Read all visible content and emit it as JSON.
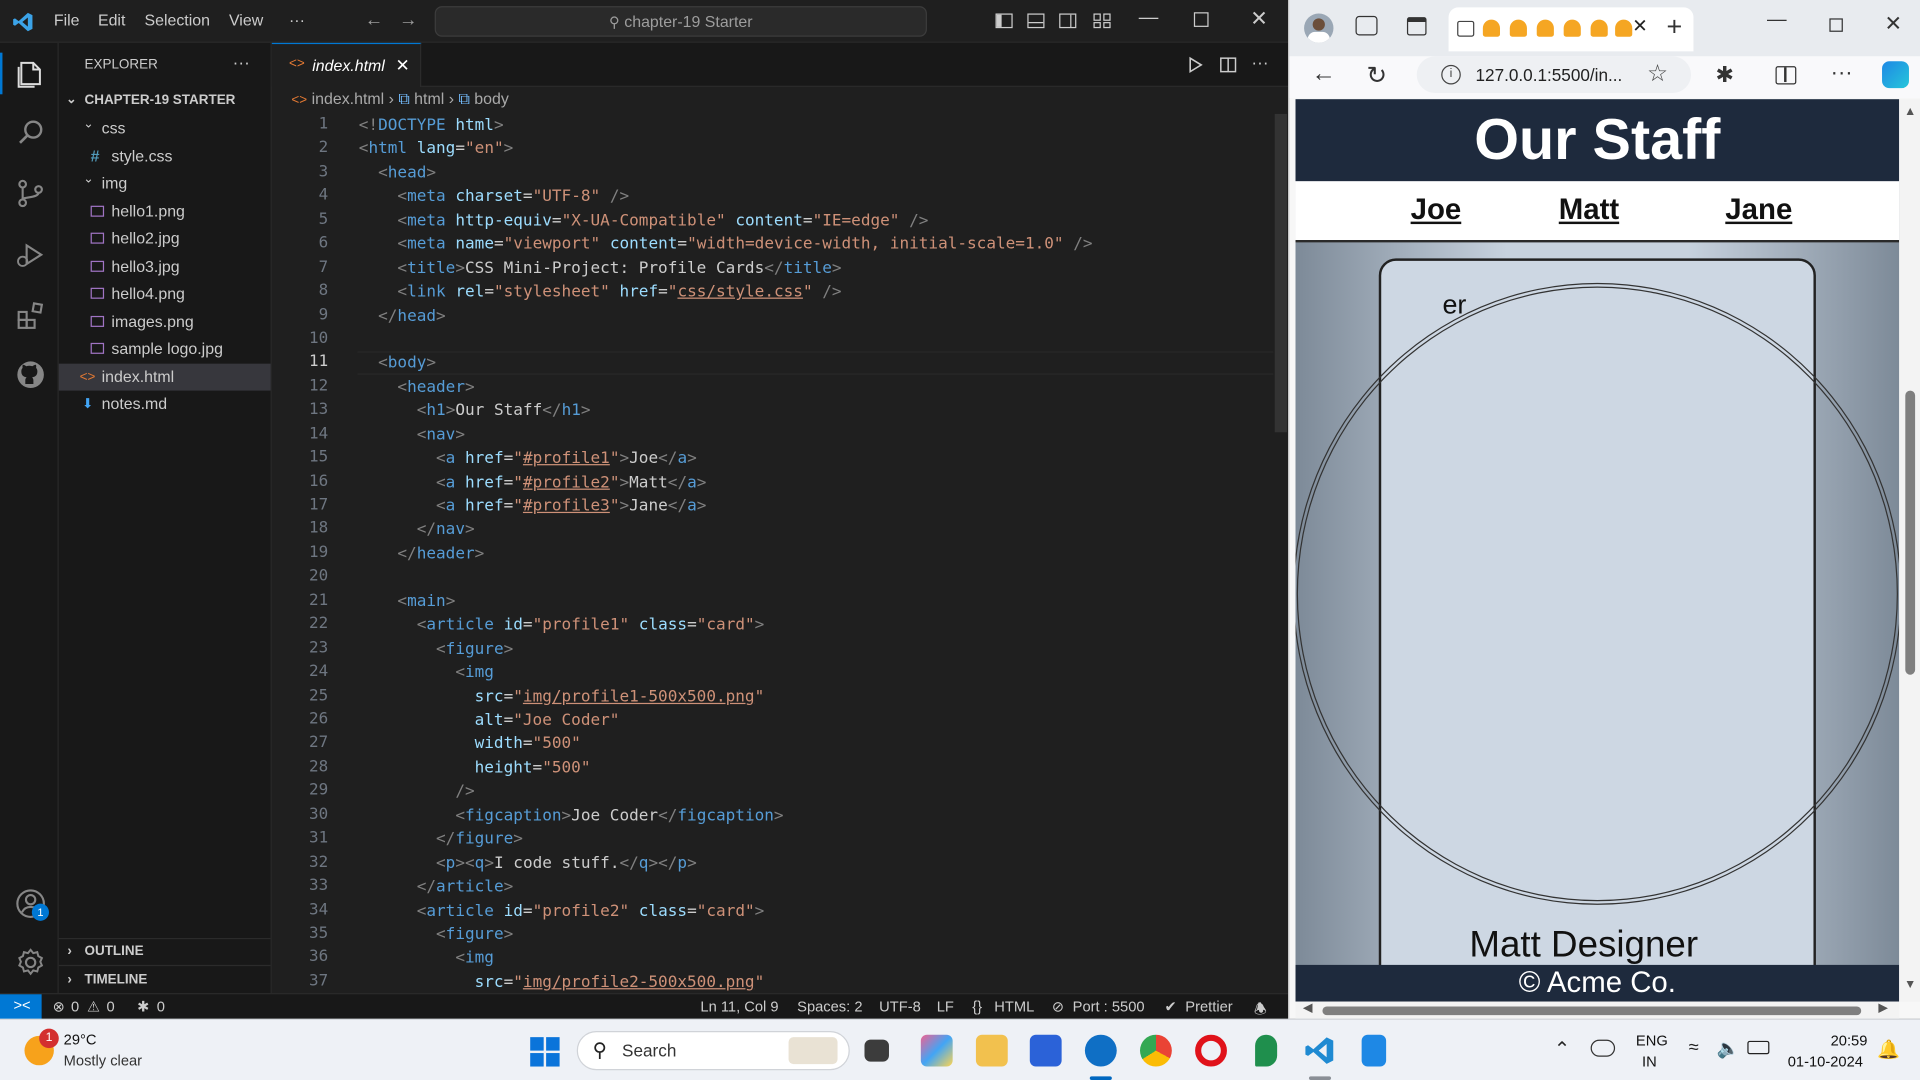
{
  "vscode": {
    "menu": [
      "File",
      "Edit",
      "Selection",
      "View",
      "···"
    ],
    "command_center": "chapter-19 Starter",
    "explorer": {
      "title": "EXPLORER",
      "more": "···",
      "root": "CHAPTER-19 STARTER",
      "items": [
        {
          "label": "css",
          "kind": "folder"
        },
        {
          "label": "style.css",
          "kind": "css"
        },
        {
          "label": "img",
          "kind": "folder"
        },
        {
          "label": "hello1.png",
          "kind": "image"
        },
        {
          "label": "hello2.jpg",
          "kind": "image"
        },
        {
          "label": "hello3.jpg",
          "kind": "image"
        },
        {
          "label": "hello4.png",
          "kind": "image"
        },
        {
          "label": "images.png",
          "kind": "image"
        },
        {
          "label": "sample logo.jpg",
          "kind": "image"
        },
        {
          "label": "index.html",
          "kind": "html"
        },
        {
          "label": "notes.md",
          "kind": "markdown"
        }
      ],
      "outline": "OUTLINE",
      "timeline": "TIMELINE"
    },
    "tab": {
      "label": "index.html",
      "close": "✕"
    },
    "breadcrumb": [
      "index.html",
      "html",
      "body"
    ],
    "current_line": 11,
    "line_numbers": [
      "1",
      "2",
      "3",
      "4",
      "5",
      "6",
      "7",
      "8",
      "9",
      "10",
      "11",
      "12",
      "13",
      "14",
      "15",
      "16",
      "17",
      "18",
      "19",
      "20",
      "21",
      "22",
      "23",
      "24",
      "25",
      "26",
      "27",
      "28",
      "29",
      "30",
      "31",
      "32",
      "33",
      "34",
      "35",
      "36",
      "37"
    ],
    "code": [
      [
        [
          "g",
          "<!"
        ],
        [
          "t",
          "DOCTYPE"
        ],
        [
          "p",
          " "
        ],
        [
          "a",
          "html"
        ],
        [
          "g",
          ">"
        ]
      ],
      [
        [
          "g",
          "<"
        ],
        [
          "t",
          "html"
        ],
        [
          "p",
          " "
        ],
        [
          "a",
          "lang"
        ],
        [
          "p",
          "="
        ],
        [
          "s",
          "\"en\""
        ],
        [
          "g",
          ">"
        ]
      ],
      [
        [
          "p",
          "  "
        ],
        [
          "g",
          "<"
        ],
        [
          "t",
          "head"
        ],
        [
          "g",
          ">"
        ]
      ],
      [
        [
          "p",
          "    "
        ],
        [
          "g",
          "<"
        ],
        [
          "t",
          "meta"
        ],
        [
          "p",
          " "
        ],
        [
          "a",
          "charset"
        ],
        [
          "p",
          "="
        ],
        [
          "s",
          "\"UTF-8\""
        ],
        [
          "p",
          " "
        ],
        [
          "g",
          "/>"
        ]
      ],
      [
        [
          "p",
          "    "
        ],
        [
          "g",
          "<"
        ],
        [
          "t",
          "meta"
        ],
        [
          "p",
          " "
        ],
        [
          "a",
          "http-equiv"
        ],
        [
          "p",
          "="
        ],
        [
          "s",
          "\"X-UA-Compatible\""
        ],
        [
          "p",
          " "
        ],
        [
          "a",
          "content"
        ],
        [
          "p",
          "="
        ],
        [
          "s",
          "\"IE=edge\""
        ],
        [
          "p",
          " "
        ],
        [
          "g",
          "/>"
        ]
      ],
      [
        [
          "p",
          "    "
        ],
        [
          "g",
          "<"
        ],
        [
          "t",
          "meta"
        ],
        [
          "p",
          " "
        ],
        [
          "a",
          "name"
        ],
        [
          "p",
          "="
        ],
        [
          "s",
          "\"viewport\""
        ],
        [
          "p",
          " "
        ],
        [
          "a",
          "content"
        ],
        [
          "p",
          "="
        ],
        [
          "s",
          "\"width=device-width, initial-scale=1.0\""
        ],
        [
          "p",
          " "
        ],
        [
          "g",
          "/>"
        ]
      ],
      [
        [
          "p",
          "    "
        ],
        [
          "g",
          "<"
        ],
        [
          "t",
          "title"
        ],
        [
          "g",
          ">"
        ],
        [
          "p",
          "CSS Mini-Project: Profile Cards"
        ],
        [
          "g",
          "</"
        ],
        [
          "t",
          "title"
        ],
        [
          "g",
          ">"
        ]
      ],
      [
        [
          "p",
          "    "
        ],
        [
          "g",
          "<"
        ],
        [
          "t",
          "link"
        ],
        [
          "p",
          " "
        ],
        [
          "a",
          "rel"
        ],
        [
          "p",
          "="
        ],
        [
          "s",
          "\"stylesheet\""
        ],
        [
          "p",
          " "
        ],
        [
          "a",
          "href"
        ],
        [
          "p",
          "="
        ],
        [
          "s",
          "\""
        ],
        [
          "su",
          "css/style.css"
        ],
        [
          "s",
          "\""
        ],
        [
          "p",
          " "
        ],
        [
          "g",
          "/>"
        ]
      ],
      [
        [
          "p",
          "  "
        ],
        [
          "g",
          "</"
        ],
        [
          "t",
          "head"
        ],
        [
          "g",
          ">"
        ]
      ],
      [
        [
          "p",
          ""
        ]
      ],
      [
        [
          "p",
          "  "
        ],
        [
          "g",
          "<"
        ],
        [
          "t",
          "body"
        ],
        [
          "g",
          ">"
        ]
      ],
      [
        [
          "p",
          "    "
        ],
        [
          "g",
          "<"
        ],
        [
          "t",
          "header"
        ],
        [
          "g",
          ">"
        ]
      ],
      [
        [
          "p",
          "      "
        ],
        [
          "g",
          "<"
        ],
        [
          "t",
          "h1"
        ],
        [
          "g",
          ">"
        ],
        [
          "p",
          "Our Staff"
        ],
        [
          "g",
          "</"
        ],
        [
          "t",
          "h1"
        ],
        [
          "g",
          ">"
        ]
      ],
      [
        [
          "p",
          "      "
        ],
        [
          "g",
          "<"
        ],
        [
          "t",
          "nav"
        ],
        [
          "g",
          ">"
        ]
      ],
      [
        [
          "p",
          "        "
        ],
        [
          "g",
          "<"
        ],
        [
          "t",
          "a"
        ],
        [
          "p",
          " "
        ],
        [
          "a",
          "href"
        ],
        [
          "p",
          "="
        ],
        [
          "s",
          "\""
        ],
        [
          "su",
          "#profile1"
        ],
        [
          "s",
          "\""
        ],
        [
          "g",
          ">"
        ],
        [
          "p",
          "Joe"
        ],
        [
          "g",
          "</"
        ],
        [
          "t",
          "a"
        ],
        [
          "g",
          ">"
        ]
      ],
      [
        [
          "p",
          "        "
        ],
        [
          "g",
          "<"
        ],
        [
          "t",
          "a"
        ],
        [
          "p",
          " "
        ],
        [
          "a",
          "href"
        ],
        [
          "p",
          "="
        ],
        [
          "s",
          "\""
        ],
        [
          "su",
          "#profile2"
        ],
        [
          "s",
          "\""
        ],
        [
          "g",
          ">"
        ],
        [
          "p",
          "Matt"
        ],
        [
          "g",
          "</"
        ],
        [
          "t",
          "a"
        ],
        [
          "g",
          ">"
        ]
      ],
      [
        [
          "p",
          "        "
        ],
        [
          "g",
          "<"
        ],
        [
          "t",
          "a"
        ],
        [
          "p",
          " "
        ],
        [
          "a",
          "href"
        ],
        [
          "p",
          "="
        ],
        [
          "s",
          "\""
        ],
        [
          "su",
          "#profile3"
        ],
        [
          "s",
          "\""
        ],
        [
          "g",
          ">"
        ],
        [
          "p",
          "Jane"
        ],
        [
          "g",
          "</"
        ],
        [
          "t",
          "a"
        ],
        [
          "g",
          ">"
        ]
      ],
      [
        [
          "p",
          "      "
        ],
        [
          "g",
          "</"
        ],
        [
          "t",
          "nav"
        ],
        [
          "g",
          ">"
        ]
      ],
      [
        [
          "p",
          "    "
        ],
        [
          "g",
          "</"
        ],
        [
          "t",
          "header"
        ],
        [
          "g",
          ">"
        ]
      ],
      [
        [
          "p",
          ""
        ]
      ],
      [
        [
          "p",
          "    "
        ],
        [
          "g",
          "<"
        ],
        [
          "t",
          "main"
        ],
        [
          "g",
          ">"
        ]
      ],
      [
        [
          "p",
          "      "
        ],
        [
          "g",
          "<"
        ],
        [
          "t",
          "article"
        ],
        [
          "p",
          " "
        ],
        [
          "a",
          "id"
        ],
        [
          "p",
          "="
        ],
        [
          "s",
          "\"profile1\""
        ],
        [
          "p",
          " "
        ],
        [
          "a",
          "class"
        ],
        [
          "p",
          "="
        ],
        [
          "s",
          "\"card\""
        ],
        [
          "g",
          ">"
        ]
      ],
      [
        [
          "p",
          "        "
        ],
        [
          "g",
          "<"
        ],
        [
          "t",
          "figure"
        ],
        [
          "g",
          ">"
        ]
      ],
      [
        [
          "p",
          "          "
        ],
        [
          "g",
          "<"
        ],
        [
          "t",
          "img"
        ]
      ],
      [
        [
          "p",
          "            "
        ],
        [
          "a",
          "src"
        ],
        [
          "p",
          "="
        ],
        [
          "s",
          "\""
        ],
        [
          "su",
          "img/profile1-500x500.png"
        ],
        [
          "s",
          "\""
        ]
      ],
      [
        [
          "p",
          "            "
        ],
        [
          "a",
          "alt"
        ],
        [
          "p",
          "="
        ],
        [
          "s",
          "\"Joe Coder\""
        ]
      ],
      [
        [
          "p",
          "            "
        ],
        [
          "a",
          "width"
        ],
        [
          "p",
          "="
        ],
        [
          "s",
          "\"500\""
        ]
      ],
      [
        [
          "p",
          "            "
        ],
        [
          "a",
          "height"
        ],
        [
          "p",
          "="
        ],
        [
          "s",
          "\"500\""
        ]
      ],
      [
        [
          "p",
          "          "
        ],
        [
          "g",
          "/>"
        ]
      ],
      [
        [
          "p",
          "          "
        ],
        [
          "g",
          "<"
        ],
        [
          "t",
          "figcaption"
        ],
        [
          "g",
          ">"
        ],
        [
          "p",
          "Joe Coder"
        ],
        [
          "g",
          "</"
        ],
        [
          "t",
          "figcaption"
        ],
        [
          "g",
          ">"
        ]
      ],
      [
        [
          "p",
          "        "
        ],
        [
          "g",
          "</"
        ],
        [
          "t",
          "figure"
        ],
        [
          "g",
          ">"
        ]
      ],
      [
        [
          "p",
          "        "
        ],
        [
          "g",
          "<"
        ],
        [
          "t",
          "p"
        ],
        [
          "g",
          "><"
        ],
        [
          "t",
          "q"
        ],
        [
          "g",
          ">"
        ],
        [
          "p",
          "I code stuff."
        ],
        [
          "g",
          "</"
        ],
        [
          "t",
          "q"
        ],
        [
          "g",
          "></"
        ],
        [
          "t",
          "p"
        ],
        [
          "g",
          ">"
        ]
      ],
      [
        [
          "p",
          "      "
        ],
        [
          "g",
          "</"
        ],
        [
          "t",
          "article"
        ],
        [
          "g",
          ">"
        ]
      ],
      [
        [
          "p",
          "      "
        ],
        [
          "g",
          "<"
        ],
        [
          "t",
          "article"
        ],
        [
          "p",
          " "
        ],
        [
          "a",
          "id"
        ],
        [
          "p",
          "="
        ],
        [
          "s",
          "\"profile2\""
        ],
        [
          "p",
          " "
        ],
        [
          "a",
          "class"
        ],
        [
          "p",
          "="
        ],
        [
          "s",
          "\"card\""
        ],
        [
          "g",
          ">"
        ]
      ],
      [
        [
          "p",
          "        "
        ],
        [
          "g",
          "<"
        ],
        [
          "t",
          "figure"
        ],
        [
          "g",
          ">"
        ]
      ],
      [
        [
          "p",
          "          "
        ],
        [
          "g",
          "<"
        ],
        [
          "t",
          "img"
        ]
      ],
      [
        [
          "p",
          "            "
        ],
        [
          "a",
          "src"
        ],
        [
          "p",
          "="
        ],
        [
          "s",
          "\""
        ],
        [
          "su",
          "img/profile2-500x500.png"
        ],
        [
          "s",
          "\""
        ]
      ]
    ],
    "status": {
      "errors": "0",
      "warnings": "0",
      "ports": "0",
      "position": "Ln 11, Col 9",
      "spaces": "Spaces: 2",
      "encoding": "UTF-8",
      "eol": "LF",
      "language": "HTML",
      "port": "Port : 5500",
      "formatter": "Prettier"
    },
    "accounts_badge": "1"
  },
  "browser": {
    "url": "127.0.0.1:5500/in...",
    "page": {
      "title": "Our Staff",
      "nav": [
        "Joe",
        "Matt",
        "Jane"
      ],
      "card_fragment": "er",
      "card_caption": "Matt Designer",
      "footer": "© Acme Co."
    }
  },
  "taskbar": {
    "weather_temp": "29°C",
    "weather_desc": "Mostly clear",
    "weather_badge": "1",
    "search_placeholder": "Search",
    "lang_top": "ENG",
    "lang_bottom": "IN",
    "time": "20:59",
    "date": "01-10-2024"
  },
  "colors": {
    "vscode_blue": "#0078d4",
    "tag": "#569cd6",
    "attr": "#9cdcfe",
    "string": "#ce9178",
    "page_header": "#1e2a3d"
  }
}
